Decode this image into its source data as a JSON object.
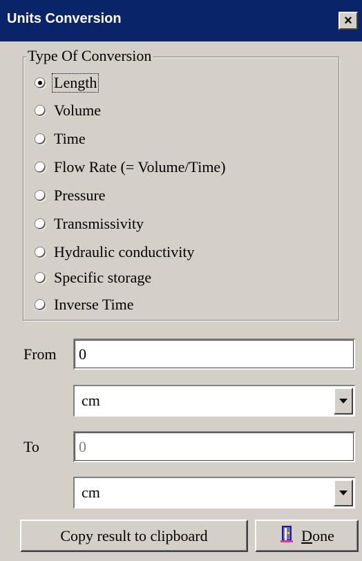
{
  "window": {
    "title": "Units Conversion",
    "close_glyph": "×"
  },
  "conversion_type": {
    "legend": "Type Of Conversion",
    "selected_index": 0,
    "options": [
      "Length",
      "Volume",
      "Time",
      "Flow Rate (= Volume/Time)",
      "Pressure",
      "Transmissivity",
      "Hydraulic conductivity",
      "Specific storage",
      "Inverse Time"
    ]
  },
  "from": {
    "label": "From",
    "value": "0",
    "unit": "cm"
  },
  "to": {
    "label": "To",
    "value": "0",
    "unit": "cm"
  },
  "buttons": {
    "copy_label": "Copy result to clipboard",
    "done_label_underlined": "D",
    "done_label_rest": "one",
    "done_icon": "done-door-icon"
  },
  "colors": {
    "titlebar": "#0a246a",
    "face": "#d4d0c8"
  }
}
